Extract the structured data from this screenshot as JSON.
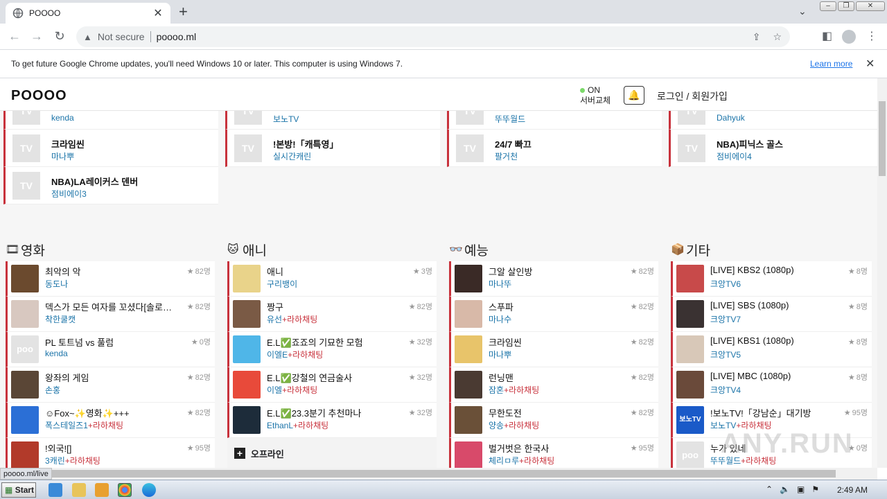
{
  "browser": {
    "tab_title": "POOOO",
    "address_warning": "Not secure",
    "url": "poooo.ml",
    "infobar_message": "To get future Google Chrome updates, you'll need Windows 10 or later. This computer is using Windows 7.",
    "infobar_link": "Learn more",
    "status_url": "poooo.ml/live"
  },
  "site": {
    "logo": "POOOO",
    "server_status": "ON",
    "server_label": "서버교체",
    "login": "로그인 / 회원가입"
  },
  "top_columns": [
    {
      "cards": [
        {
          "thumb": "TV",
          "title": "",
          "channel": "kenda"
        },
        {
          "thumb": "TV",
          "title": "크라임씬",
          "channel": "마나뿌"
        },
        {
          "thumb": "TV",
          "title": "NBA)LA레이커스 덴버",
          "channel": "점비에이3"
        }
      ]
    },
    {
      "cards": [
        {
          "thumb": "TV",
          "title": "",
          "channel": "보노TV"
        },
        {
          "thumb": "TV",
          "title": "!본방!「캐특영」",
          "channel": "실시간캐린"
        }
      ]
    },
    {
      "cards": [
        {
          "thumb": "TV",
          "title": "",
          "channel": "뚜뚜월드"
        },
        {
          "thumb": "TV",
          "title": "24/7 빠끄",
          "channel": "팔거천"
        }
      ]
    },
    {
      "cards": [
        {
          "thumb": "TV",
          "title": "",
          "channel": "Dahyuk"
        },
        {
          "thumb": "TV",
          "title": "NBA)피닉스 골스",
          "channel": "점비에이4"
        }
      ]
    }
  ],
  "categories": [
    {
      "icon": "film-icon",
      "glyph": "🎞",
      "title": "영화",
      "items": [
        {
          "name": "최악의 악",
          "channel": "동도나",
          "extra": "",
          "count": "82명",
          "color": "#6b4a2e"
        },
        {
          "name": "덱스가 모든 여자를 꼬셨다[솔로지옥]",
          "channel": "착한쿨캣",
          "extra": "",
          "count": "82명",
          "color": "#d8c8c0"
        },
        {
          "name": "PL 토트넘 vs 풀럼",
          "channel": "kenda",
          "extra": "",
          "count": "0명",
          "color": "#e3e3e3",
          "thumb_text": "poo"
        },
        {
          "name": "왕좌의 게임",
          "channel": "손홍",
          "extra": "",
          "count": "82명",
          "color": "#5a4636"
        },
        {
          "name": "☺Fox~✨영화✨+++",
          "channel": "폭스테일즈1",
          "extra": "+라하채팅",
          "count": "82명",
          "color": "#2b6fd6"
        },
        {
          "name": "!외국![]",
          "channel": "3캐린",
          "extra": "+라하채팅",
          "count": "95명",
          "color": "#b23a2a"
        }
      ]
    },
    {
      "icon": "anime-icon",
      "glyph": "🐱",
      "title": "애니",
      "items": [
        {
          "name": "애니",
          "channel": "구리뱅이",
          "extra": "",
          "count": "3명",
          "color": "#e9d38a"
        },
        {
          "name": "짱구",
          "channel": "유선",
          "extra": "+라하채팅",
          "count": "82명",
          "color": "#7a5a45"
        },
        {
          "name": "E.L✅죠죠의 기묘한 모험",
          "channel": "이엘E",
          "extra": "+라하채팅",
          "count": "32명",
          "color": "#4fb6e8"
        },
        {
          "name": "E.L✅강철의 연금술사",
          "channel": "이엘",
          "extra": "+라하채팅",
          "count": "32명",
          "color": "#e84a3a"
        },
        {
          "name": "E.L✅23.3분기 추천마나",
          "channel": "EthanL",
          "extra": "+라하채팅",
          "count": "32명",
          "color": "#1d2c3a"
        }
      ],
      "offline": "오프라인"
    },
    {
      "icon": "variety-icon",
      "glyph": "👓",
      "title": "예능",
      "items": [
        {
          "name": "그알 살인방",
          "channel": "마나뚜",
          "extra": "",
          "count": "82명",
          "color": "#3a2a26"
        },
        {
          "name": "스푸파",
          "channel": "마나수",
          "extra": "",
          "count": "82명",
          "color": "#d8b9a8"
        },
        {
          "name": "크라임씬",
          "channel": "마나뿌",
          "extra": "",
          "count": "82명",
          "color": "#e8c46a"
        },
        {
          "name": "런닝맨",
          "channel": "잠혼",
          "extra": "+라하채팅",
          "count": "82명",
          "color": "#4a3a32"
        },
        {
          "name": "무한도전",
          "channel": "양송",
          "extra": "+라하채팅",
          "count": "82명",
          "color": "#6a5038"
        },
        {
          "name": "벌거벗은 한국사",
          "channel": "체리ㅁ루",
          "extra": "+라하채팅",
          "count": "95명",
          "color": "#d84a6a"
        }
      ]
    },
    {
      "icon": "other-icon",
      "glyph": "📦",
      "title": "기타",
      "items": [
        {
          "name": "[LIVE] KBS2 (1080p)",
          "channel": "크앙TV6",
          "extra": "",
          "count": "8명",
          "color": "#c84a4a"
        },
        {
          "name": "[LIVE] SBS (1080p)",
          "channel": "크앙TV7",
          "extra": "",
          "count": "8명",
          "color": "#3a3232"
        },
        {
          "name": "[LIVE] KBS1 (1080p)",
          "channel": "크앙TV5",
          "extra": "",
          "count": "8명",
          "color": "#d8c8b8"
        },
        {
          "name": "[LIVE] MBC (1080p)",
          "channel": "크앙TV4",
          "extra": "",
          "count": "8명",
          "color": "#6a4a3a"
        },
        {
          "name": "!보노TV!「강남순」대기방",
          "channel": "보노TV",
          "extra": "+라하채팅",
          "count": "95명",
          "color": "#1a5ac8",
          "thumb_text": "보노TV"
        },
        {
          "name": "누가 있네",
          "channel": "뚜뚜월드",
          "extra": "+라하채팅",
          "count": "0명",
          "color": "#e3e3e3",
          "thumb_text": "poo"
        }
      ]
    }
  ],
  "taskbar": {
    "start": "Start",
    "clock": "2:49 AM"
  },
  "watermark": "ANY.RUN"
}
